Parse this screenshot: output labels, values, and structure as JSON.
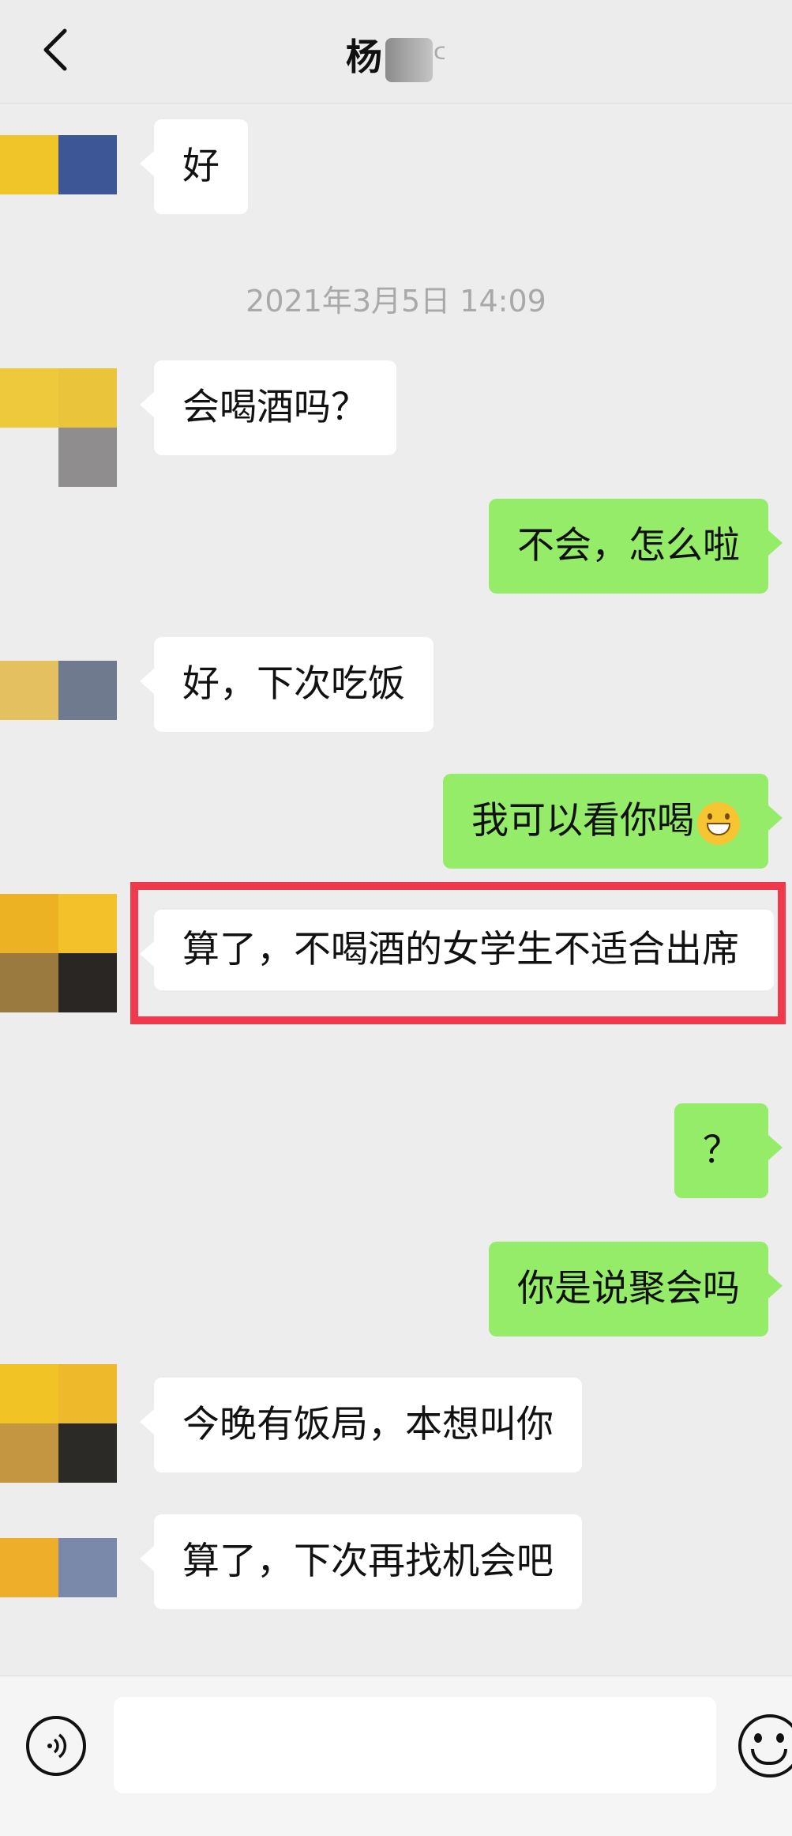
{
  "header": {
    "title_visible": "杨",
    "title_icon": "ear-icon"
  },
  "timestamp": "2021年3月5日 14:09",
  "messages": [
    {
      "side": "in",
      "text": "好"
    },
    {
      "side": "in",
      "text": "会喝酒吗？"
    },
    {
      "side": "out",
      "text": "不会，怎么啦"
    },
    {
      "side": "in",
      "text": "好，下次吃饭"
    },
    {
      "side": "out",
      "text": "我可以看你喝",
      "emoji": "grinning-face-icon"
    },
    {
      "side": "in",
      "text": "算了，不喝酒的女学生不适合出席",
      "highlighted": true
    },
    {
      "side": "out",
      "text": "？"
    },
    {
      "side": "out",
      "text": "你是说聚会吗"
    },
    {
      "side": "in",
      "text": "今晚有饭局，本想叫你"
    },
    {
      "side": "in",
      "text": "算了，下次再找机会吧"
    }
  ],
  "colors": {
    "background": "#ededed",
    "incoming_bubble": "#ffffff",
    "outgoing_bubble": "#95ec69",
    "highlight_border": "#ee3a4c"
  },
  "footer": {
    "voice_icon": "voice-icon",
    "emoji_icon": "smile-icon",
    "input_value": ""
  }
}
